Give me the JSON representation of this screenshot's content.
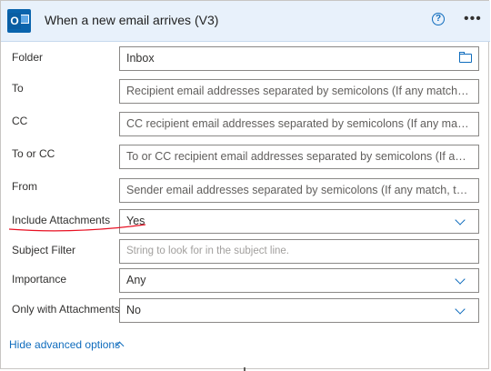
{
  "header": {
    "title": "When a new email arrives (V3)",
    "help_icon": "?",
    "more_icon": "•••"
  },
  "fields": [
    {
      "label": "Folder",
      "value": "Inbox",
      "placeholder": ""
    },
    {
      "label": "To",
      "value": "",
      "placeholder": "Recipient email addresses separated by semicolons (If any match, t..."
    },
    {
      "label": "CC",
      "value": "",
      "placeholder": "CC recipient email addresses separated by semicolons (If any matc..."
    },
    {
      "label": "To or CC",
      "value": "",
      "placeholder": "To or CC recipient email addresses separated by semicolons (If any ..."
    },
    {
      "label": "From",
      "value": "",
      "placeholder": "Sender email addresses separated by semicolons (If any match, the..."
    },
    {
      "label": "Include Attachments",
      "value": "Yes"
    },
    {
      "label": "Subject Filter",
      "value": "",
      "placeholder": "String to look for in the subject line."
    },
    {
      "label": "Importance",
      "value": "Any"
    },
    {
      "label": "Only with Attachments",
      "value": "No"
    }
  ],
  "advanced_toggle": "Hide advanced options",
  "colors": {
    "accent": "#0f6cbd",
    "header_bg": "#e8f1fb",
    "annotation": "#e81123"
  }
}
